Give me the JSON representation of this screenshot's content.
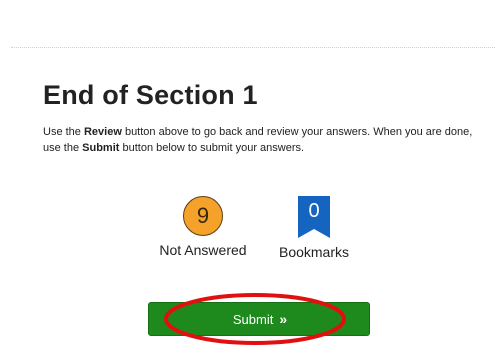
{
  "section": {
    "title": "End of Section 1"
  },
  "instructions": {
    "part1": "Use the ",
    "review_word": "Review",
    "part2": " button above to go back and review your answers. When you are done, use the ",
    "submit_word": "Submit",
    "part3": " button below to submit your answers."
  },
  "stats": {
    "not_answered": {
      "count": "9",
      "label": "Not Answered",
      "color": "#f5a22a"
    },
    "bookmarks": {
      "count": "0",
      "label": "Bookmarks",
      "color": "#1565c0"
    }
  },
  "submit_button": {
    "label": "Submit",
    "icon": "double-chevron-right-icon",
    "color": "#1e8a1e"
  },
  "annotation": {
    "type": "red-ellipse-highlight",
    "color": "#e01010"
  }
}
